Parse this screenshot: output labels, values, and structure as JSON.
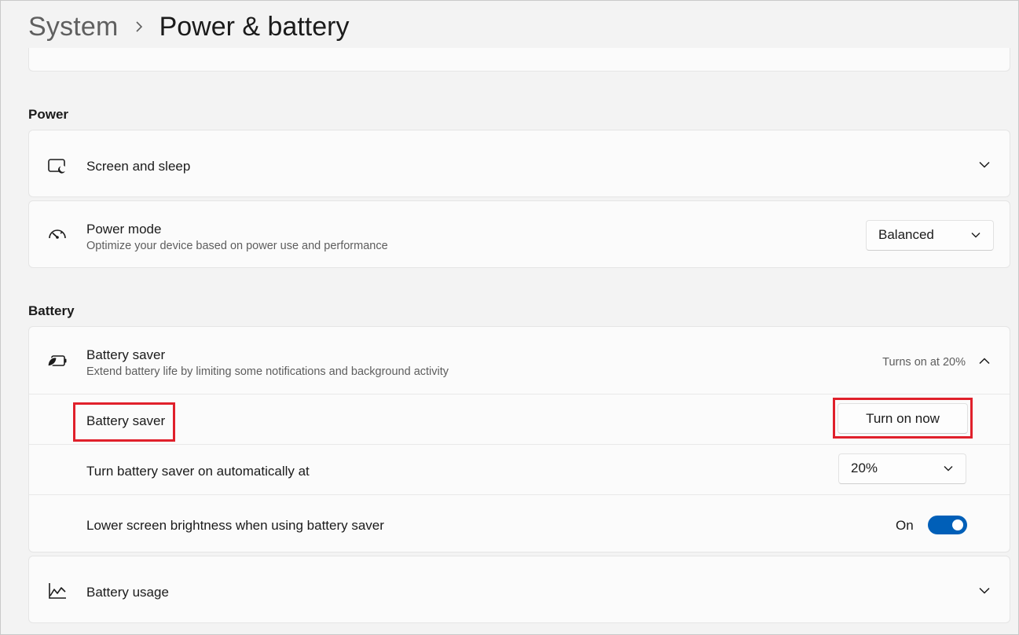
{
  "breadcrumb": {
    "parent": "System",
    "separator_icon": "chevron-right-icon",
    "current": "Power & battery"
  },
  "sections": {
    "power_label": "Power",
    "battery_label": "Battery"
  },
  "screen_and_sleep": {
    "icon": "screen-sleep-icon",
    "title": "Screen and sleep",
    "expand_icon": "chevron-down-icon"
  },
  "power_mode": {
    "icon": "speedometer-icon",
    "title": "Power mode",
    "subtitle": "Optimize your device based on power use and performance",
    "selected": "Balanced"
  },
  "battery_saver": {
    "icon": "battery-leaf-icon",
    "title": "Battery saver",
    "subtitle": "Extend battery life by limiting some notifications and background activity",
    "status": "Turns on at 20%",
    "collapse_icon": "chevron-up-icon",
    "sub_rows": {
      "saver_label": "Battery saver",
      "turn_on_button": "Turn on now",
      "auto_label": "Turn battery saver on automatically at",
      "auto_value": "20%",
      "brightness_label": "Lower screen brightness when using battery saver",
      "brightness_state": "On",
      "brightness_toggle_on": true
    }
  },
  "battery_usage": {
    "icon": "line-chart-icon",
    "title": "Battery usage",
    "expand_icon": "chevron-down-icon"
  },
  "colors": {
    "accent": "#005fb8",
    "highlight_box": "#e0202b"
  }
}
